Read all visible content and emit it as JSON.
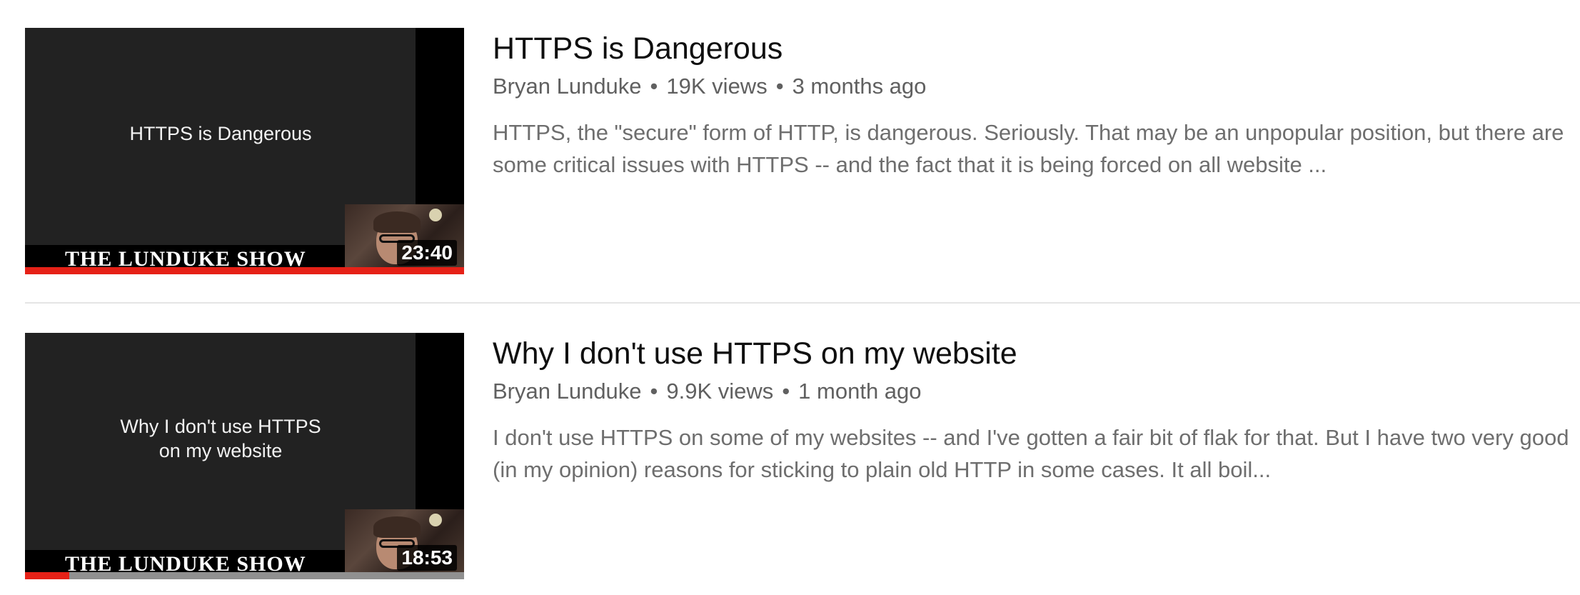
{
  "results": [
    {
      "thumbnail_text": "HTTPS is Dangerous",
      "show_logo": "THE LUNDUKE SHOW",
      "duration": "23:40",
      "watched_fraction": 1.0,
      "title": "HTTPS is Dangerous",
      "channel": "Bryan Lunduke",
      "views": "19K views",
      "age": "3 months ago",
      "description": "HTTPS, the \"secure\" form of HTTP, is dangerous. Seriously. That may be an unpopular position, but there are some critical issues with HTTPS -- and the fact that it is being forced on all website ..."
    },
    {
      "thumbnail_text": "Why I don't use HTTPS\non my website",
      "show_logo": "THE LUNDUKE SHOW",
      "duration": "18:53",
      "watched_fraction": 0.1,
      "title": "Why I don't use HTTPS on my website",
      "channel": "Bryan Lunduke",
      "views": "9.9K views",
      "age": "1 month ago",
      "description": "I don't use HTTPS on some of my websites -- and I've gotten a fair bit of flak for that. But I have two very good (in my opinion) reasons for sticking to plain old HTTP in some cases. It all boil..."
    }
  ],
  "separator_dot": "•",
  "colors": {
    "title": "#0f0f0f",
    "meta": "#606060",
    "progress_watched": "#e62117",
    "progress_unwatched": "#909090"
  }
}
